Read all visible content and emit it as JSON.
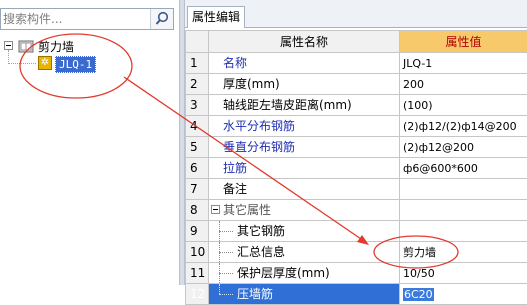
{
  "left_panel": {
    "search_placeholder": "搜索构件...",
    "tree": {
      "root_label": "剪力墙",
      "child_label": "JLQ-1"
    }
  },
  "right_panel": {
    "tab_label": "属性编辑",
    "columns": {
      "name": "属性名称",
      "value": "属性值"
    },
    "rows": [
      {
        "num": "1",
        "name": "名称",
        "value": "JLQ-1"
      },
      {
        "num": "2",
        "name": "厚度(mm)",
        "value": "200"
      },
      {
        "num": "3",
        "name": "轴线距左墙皮距离(mm)",
        "value": "(100)"
      },
      {
        "num": "4",
        "name": "水平分布钢筋",
        "value": "(2)ф12/(2)ф14@200"
      },
      {
        "num": "5",
        "name": "垂直分布钢筋",
        "value": "(2)ф12@200"
      },
      {
        "num": "6",
        "name": "拉筋",
        "value": "ф6@600*600"
      },
      {
        "num": "7",
        "name": "备注",
        "value": ""
      },
      {
        "num": "8",
        "name": "其它属性",
        "value": ""
      },
      {
        "num": "9",
        "name": "其它钢筋",
        "value": ""
      },
      {
        "num": "10",
        "name": "汇总信息",
        "value": "剪力墙"
      },
      {
        "num": "11",
        "name": "保护层厚度(mm)",
        "value": "10/50"
      },
      {
        "num": "12",
        "name": "压墙筋",
        "value": "6C20"
      }
    ]
  },
  "colors": {
    "annotation_red": "#e23a2e",
    "header_value_bg": "#f7c96b",
    "selection_blue": "#2f6fd6"
  }
}
